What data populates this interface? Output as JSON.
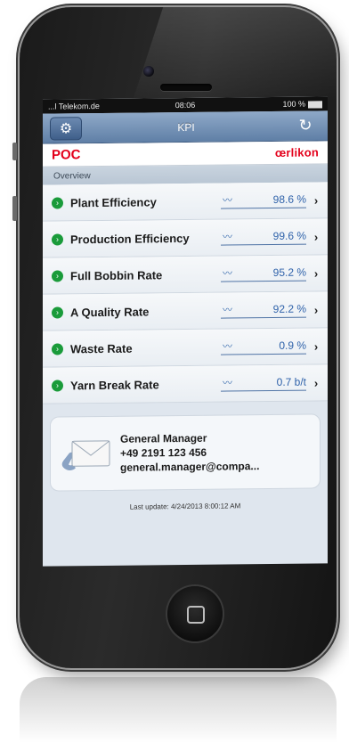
{
  "status_bar": {
    "carrier": "...l Telekom.de",
    "time": "08:06",
    "battery": "100 %"
  },
  "nav": {
    "title": "KPI",
    "settings_icon": "gear-icon",
    "refresh_icon": "refresh-icon"
  },
  "brand": {
    "left": "POC",
    "right": "œrlikon",
    "color": "#e3001b"
  },
  "section": {
    "title": "Overview"
  },
  "kpis": [
    {
      "label": "Plant Efficiency",
      "value": "98.6 %"
    },
    {
      "label": "Production Efficiency",
      "value": "99.6 %"
    },
    {
      "label": "Full Bobbin Rate",
      "value": "95.2 %"
    },
    {
      "label": "A Quality Rate",
      "value": "92.2 %"
    },
    {
      "label": "Waste Rate",
      "value": "0.9 %"
    },
    {
      "label": "Yarn Break Rate",
      "value": "0.7 b/t"
    }
  ],
  "contact": {
    "name": "General Manager",
    "phone": "+49 2191 123 456",
    "email": "general.manager@compa..."
  },
  "footer": {
    "last_update": "Last update: 4/24/2013 8:00:12 AM"
  },
  "colors": {
    "status_ok": "#1a9b3a",
    "value_link": "#2f62aa",
    "navbar": "#6f8db3"
  }
}
